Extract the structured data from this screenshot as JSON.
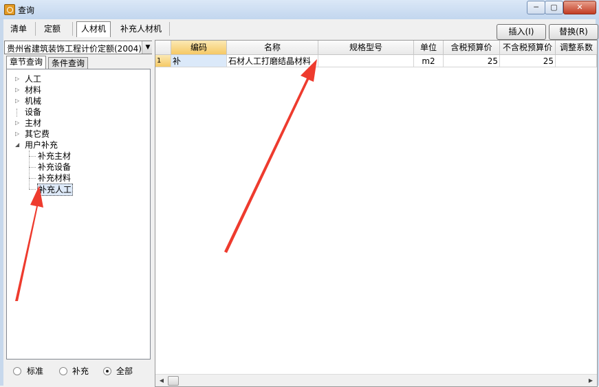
{
  "window": {
    "title": "查询",
    "controls": {
      "minimize": "─",
      "maximize": "▢",
      "close": "✕"
    }
  },
  "tabs": {
    "items": [
      "清单",
      "定额",
      "人材机",
      "补充人材机"
    ],
    "active_index": 2
  },
  "actions": {
    "insert": "插入(I)",
    "replace": "替换(R)"
  },
  "left_pane": {
    "quota_select": "贵州省建筑装饰工程计价定额(2004)",
    "subtabs": [
      "章节查询",
      "条件查询"
    ],
    "tree": [
      {
        "label": "人工",
        "expandable": true
      },
      {
        "label": "材料",
        "expandable": true
      },
      {
        "label": "机械",
        "expandable": true
      },
      {
        "label": "设备",
        "expandable": false
      },
      {
        "label": "主材",
        "expandable": true
      },
      {
        "label": "其它费",
        "expandable": true
      },
      {
        "label": "用户补充",
        "expanded": true,
        "children": [
          "补充主材",
          "补充设备",
          "补充材料",
          "补充人工"
        ],
        "selected_child": "补充人工"
      }
    ],
    "filter": {
      "options": [
        "标准",
        "补充",
        "全部"
      ],
      "selected": "全部"
    }
  },
  "grid": {
    "columns": [
      "编码",
      "名称",
      "规格型号",
      "单位",
      "含税预算价",
      "不含税预算价",
      "调整系数"
    ],
    "rows": [
      {
        "no": "1",
        "code": "补",
        "name": "石材人工打磨结晶材料",
        "spec": "",
        "unit": "m2",
        "price_tax": "25",
        "price_notax": "25",
        "factor": ""
      }
    ]
  },
  "annotations": {
    "arrow_color": "#ee3b2e"
  }
}
